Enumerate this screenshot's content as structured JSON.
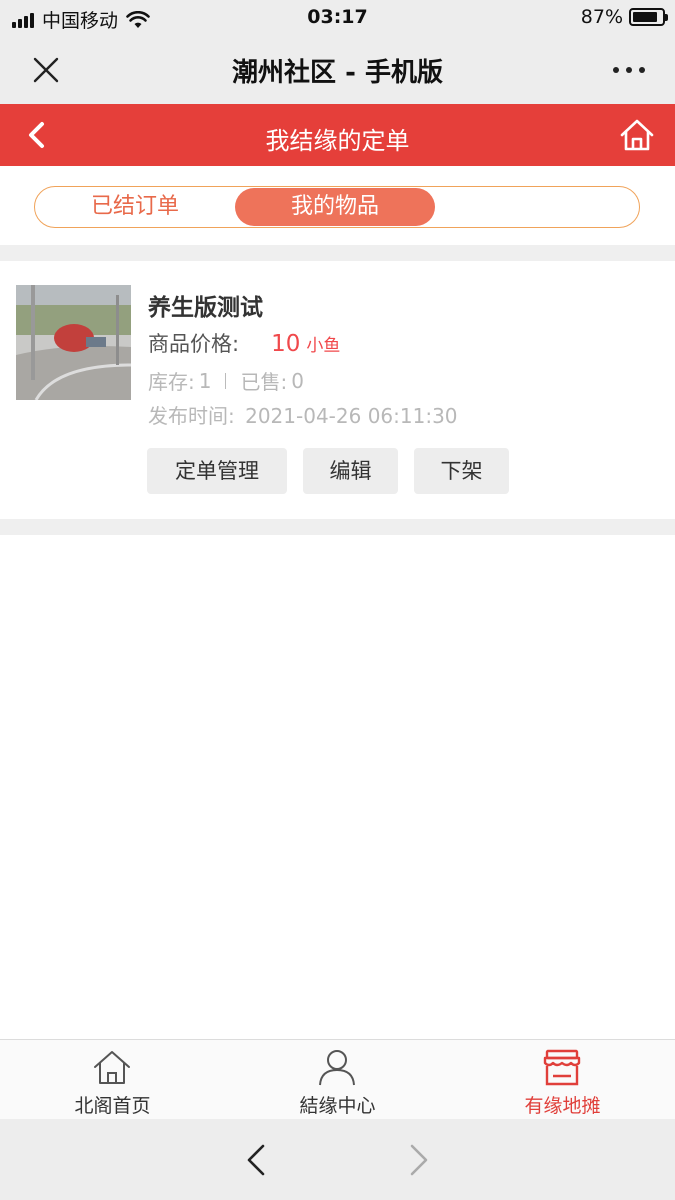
{
  "status_bar": {
    "carrier": "中国移动",
    "time": "03:17",
    "battery": "87%",
    "battery_level": 0.87
  },
  "wechat_nav": {
    "title": "潮州社区 - 手机版",
    "icons": [
      "close-icon",
      "more-icon"
    ]
  },
  "header": {
    "title": "我结缘的定单",
    "icons": [
      "back-icon",
      "home-icon"
    ],
    "color": "#e53f3a"
  },
  "segment": {
    "tabs": [
      {
        "label": "已结订单",
        "active": false
      },
      {
        "label": "我的物品",
        "active": true
      }
    ],
    "accent": "#ee735a"
  },
  "product": {
    "name": "养生版测试",
    "price_label": "商品价格:",
    "price": "10",
    "price_unit": "小鱼",
    "stock_label": "库存:",
    "stock_value": "1",
    "sold_label": "已售:",
    "sold_value": "0",
    "time_label": "发布时间:",
    "time_value": "2021-04-26 06:11:30",
    "buttons": [
      "定单管理",
      "编辑",
      "下架"
    ]
  },
  "tabbar": {
    "items": [
      {
        "label": "北阁首页",
        "icon": "house-icon",
        "active": false
      },
      {
        "label": "結缘中心",
        "icon": "user-icon",
        "active": false
      },
      {
        "label": "有缘地摊",
        "icon": "shop-icon",
        "active": true
      }
    ],
    "active_color": "#e03f3a"
  },
  "browser_bar": {
    "icons": [
      "back-arrow-icon",
      "forward-arrow-icon"
    ]
  }
}
